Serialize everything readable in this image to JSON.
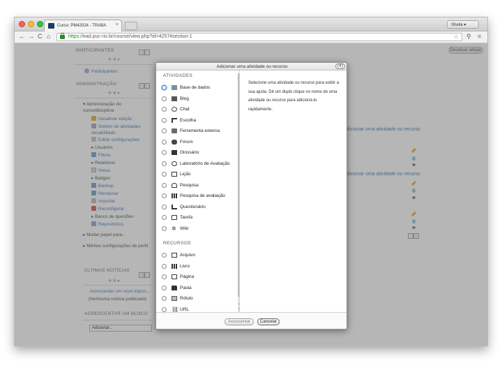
{
  "browser": {
    "tab_title": "Curso: PM42024 - TRABA",
    "tab_close": "×",
    "user_label": "Sheila",
    "url_scheme": "https://",
    "url_rest": "ead.puc-rio.br/course/view.php?id=4257#section-1",
    "nav_back": "←",
    "nav_forward": "→",
    "nav_reload": "C",
    "nav_home": "⌂",
    "star": "☆",
    "zoom": "⚲",
    "menu": "≡",
    "colors": {
      "close": "#ff5f57",
      "minimize": "#febc2e",
      "zoom": "#28c840"
    }
  },
  "header": {
    "edit_button": "Desativar edição"
  },
  "sidebar": {
    "participants": {
      "heading": "PARTICIPANTES",
      "link": "Participantes"
    },
    "admin": {
      "heading": "ADMINISTRAÇÃO",
      "course_admin": "Administração do curso/disciplina",
      "items": [
        "Desativar edição",
        "Seletor de atividades desabilitado",
        "Editar configurações",
        "Usuários",
        "Filtros",
        "Relatórios",
        "Notas",
        "Badges",
        "Backup",
        "Restaurar",
        "Importar",
        "Reconfigurar",
        "Banco de questões",
        "Repositórios"
      ],
      "switch_role": "Mudar papel para...",
      "profile_settings": "Minhas configurações de perfil"
    },
    "news": {
      "heading": "ÚLTIMAS NOTÍCIAS",
      "add_topic": "Acrescentar um novo tópico...",
      "empty": "(Nenhuma notícia publicada)"
    },
    "add_block": {
      "heading": "ACRESCENTAR UM BLOCO",
      "select": "Adicionar..."
    },
    "controls": "✣ ✲ ▾"
  },
  "main": {
    "add_activity_link": "Adicionar uma atividade ou recurso"
  },
  "modal": {
    "title": "Adicionar uma atividade ou recurso",
    "close": "(X)",
    "activities_label": "ATIVIDADES",
    "activities": [
      "Base de dados",
      "Blog",
      "Chat",
      "Escolha",
      "Ferramenta externa",
      "Fórum",
      "Glossário",
      "Laboratório de Avaliação",
      "Lição",
      "Pesquisa",
      "Pesquisa de avaliação",
      "Questionário",
      "Tarefa",
      "Wiki"
    ],
    "resources_label": "RECURSOS",
    "resources": [
      "Arquivo",
      "Livro",
      "Página",
      "Pasta",
      "Rótulo",
      "URL"
    ],
    "description": "Selecione uma atividade ou recurso para exibir a sua ajuda. Dê um duplo clique no nome de uma atividade ou recurso para adicioná-lo rapidamente.",
    "add_button": "Acrescentar",
    "cancel_button": "Cancelar"
  }
}
